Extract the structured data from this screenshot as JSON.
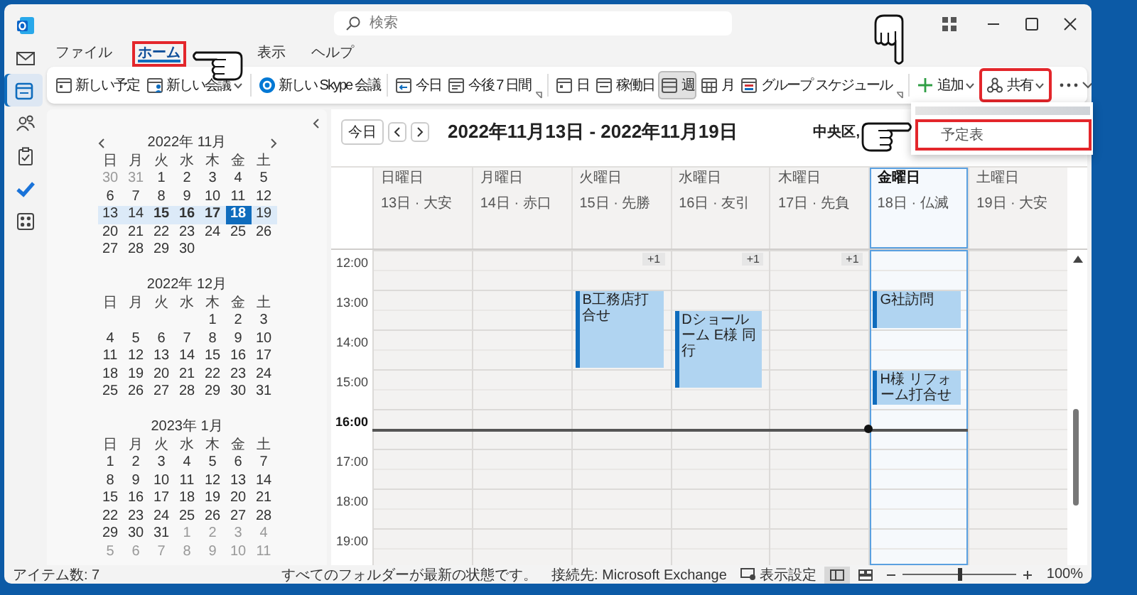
{
  "window": {
    "search": {
      "placeholder": "検索"
    }
  },
  "nav_rail": [
    {
      "selected": false
    },
    {
      "selected": true
    },
    {
      "selected": false
    },
    {
      "selected": false
    },
    {
      "selected": false
    },
    {
      "selected": false
    }
  ],
  "menu_tabs": [
    {
      "label": "ファイル",
      "selected": false,
      "annotated": false
    },
    {
      "label": "ホーム",
      "selected": true,
      "annotated": true
    },
    {
      "label": "表示",
      "selected": false,
      "annotated": false
    },
    {
      "label": "ヘルプ",
      "selected": false,
      "annotated": false
    }
  ],
  "ribbon": {
    "groups": [
      {
        "launcher": false,
        "items": [
          {
            "label": "新しい予定",
            "dropdown": false,
            "selected": false,
            "annotated": false
          },
          {
            "label": "新しい会議",
            "dropdown": true,
            "selected": false,
            "annotated": false
          }
        ]
      },
      {
        "launcher": false,
        "items": [
          {
            "label": "新しい Skype 会議",
            "dropdown": false,
            "selected": false,
            "annotated": false
          }
        ]
      },
      {
        "launcher": true,
        "items": [
          {
            "label": "今日",
            "dropdown": false,
            "selected": false,
            "annotated": false
          },
          {
            "label": "今後 7 日間",
            "dropdown": false,
            "selected": false,
            "annotated": false
          }
        ]
      },
      {
        "launcher": true,
        "items": [
          {
            "label": "日",
            "dropdown": false,
            "selected": false,
            "annotated": false
          },
          {
            "label": "稼働日",
            "dropdown": false,
            "selected": false,
            "annotated": false
          },
          {
            "label": "週",
            "dropdown": false,
            "selected": true,
            "annotated": false
          },
          {
            "label": "月",
            "dropdown": false,
            "selected": false,
            "annotated": false
          },
          {
            "label": "グループ スケジュール",
            "dropdown": false,
            "selected": false,
            "annotated": false
          }
        ]
      },
      {
        "launcher": false,
        "items": [
          {
            "label": "追加",
            "dropdown": true,
            "selected": false,
            "annotated": false
          },
          {
            "label": "共有",
            "dropdown": true,
            "selected": false,
            "annotated": true
          }
        ]
      }
    ]
  },
  "share_menu": {
    "items": [
      {
        "label": "予定表",
        "annotated": true
      }
    ]
  },
  "mini_calendars": [
    {
      "title": "2022年 11月",
      "weekdays": [
        "日",
        "月",
        "火",
        "水",
        "木",
        "金",
        "土"
      ],
      "weeks": [
        {
          "selected": false,
          "days": [
            {
              "day": "30",
              "muted": true,
              "bold": false,
              "selected": false
            },
            {
              "day": "31",
              "muted": true,
              "bold": false,
              "selected": false
            },
            {
              "day": "1",
              "muted": false,
              "bold": false,
              "selected": false
            },
            {
              "day": "2",
              "muted": false,
              "bold": false,
              "selected": false
            },
            {
              "day": "3",
              "muted": false,
              "bold": false,
              "selected": false
            },
            {
              "day": "4",
              "muted": false,
              "bold": false,
              "selected": false
            },
            {
              "day": "5",
              "muted": false,
              "bold": false,
              "selected": false
            }
          ]
        },
        {
          "selected": false,
          "days": [
            {
              "day": "6",
              "muted": false,
              "bold": false,
              "selected": false
            },
            {
              "day": "7",
              "muted": false,
              "bold": false,
              "selected": false
            },
            {
              "day": "8",
              "muted": false,
              "bold": false,
              "selected": false
            },
            {
              "day": "9",
              "muted": false,
              "bold": false,
              "selected": false
            },
            {
              "day": "10",
              "muted": false,
              "bold": false,
              "selected": false
            },
            {
              "day": "11",
              "muted": false,
              "bold": false,
              "selected": false
            },
            {
              "day": "12",
              "muted": false,
              "bold": false,
              "selected": false
            }
          ]
        },
        {
          "selected": true,
          "days": [
            {
              "day": "13",
              "muted": false,
              "bold": false,
              "selected": false
            },
            {
              "day": "14",
              "muted": false,
              "bold": false,
              "selected": false
            },
            {
              "day": "15",
              "muted": false,
              "bold": true,
              "selected": false
            },
            {
              "day": "16",
              "muted": false,
              "bold": true,
              "selected": false
            },
            {
              "day": "17",
              "muted": false,
              "bold": true,
              "selected": false
            },
            {
              "day": "18",
              "muted": false,
              "bold": true,
              "selected": true
            },
            {
              "day": "19",
              "muted": false,
              "bold": false,
              "selected": false
            }
          ]
        },
        {
          "selected": false,
          "days": [
            {
              "day": "20",
              "muted": false,
              "bold": false,
              "selected": false
            },
            {
              "day": "21",
              "muted": false,
              "bold": false,
              "selected": false
            },
            {
              "day": "22",
              "muted": false,
              "bold": false,
              "selected": false
            },
            {
              "day": "23",
              "muted": false,
              "bold": false,
              "selected": false
            },
            {
              "day": "24",
              "muted": false,
              "bold": false,
              "selected": false
            },
            {
              "day": "25",
              "muted": false,
              "bold": false,
              "selected": false
            },
            {
              "day": "26",
              "muted": false,
              "bold": false,
              "selected": false
            }
          ]
        },
        {
          "selected": false,
          "days": [
            {
              "day": "27",
              "muted": false,
              "bold": false,
              "selected": false
            },
            {
              "day": "28",
              "muted": false,
              "bold": false,
              "selected": false
            },
            {
              "day": "29",
              "muted": false,
              "bold": false,
              "selected": false
            },
            {
              "day": "30",
              "muted": false,
              "bold": false,
              "selected": false
            }
          ]
        }
      ]
    },
    {
      "title": "2022年 12月",
      "weekdays": [
        "日",
        "月",
        "火",
        "水",
        "木",
        "金",
        "土"
      ],
      "weeks": [
        {
          "selected": false,
          "days": [
            {
              "day": "1",
              "muted": false,
              "bold": false,
              "selected": false
            },
            {
              "day": "2",
              "muted": false,
              "bold": false,
              "selected": false
            },
            {
              "day": "3",
              "muted": false,
              "bold": false,
              "selected": false
            }
          ]
        },
        {
          "selected": false,
          "days": [
            {
              "day": "4",
              "muted": false,
              "bold": false,
              "selected": false
            },
            {
              "day": "5",
              "muted": false,
              "bold": false,
              "selected": false
            },
            {
              "day": "6",
              "muted": false,
              "bold": false,
              "selected": false
            },
            {
              "day": "7",
              "muted": false,
              "bold": false,
              "selected": false
            },
            {
              "day": "8",
              "muted": false,
              "bold": false,
              "selected": false
            },
            {
              "day": "9",
              "muted": false,
              "bold": false,
              "selected": false
            },
            {
              "day": "10",
              "muted": false,
              "bold": false,
              "selected": false
            }
          ]
        },
        {
          "selected": false,
          "days": [
            {
              "day": "11",
              "muted": false,
              "bold": false,
              "selected": false
            },
            {
              "day": "12",
              "muted": false,
              "bold": false,
              "selected": false
            },
            {
              "day": "13",
              "muted": false,
              "bold": false,
              "selected": false
            },
            {
              "day": "14",
              "muted": false,
              "bold": false,
              "selected": false
            },
            {
              "day": "15",
              "muted": false,
              "bold": false,
              "selected": false
            },
            {
              "day": "16",
              "muted": false,
              "bold": false,
              "selected": false
            },
            {
              "day": "17",
              "muted": false,
              "bold": false,
              "selected": false
            }
          ]
        },
        {
          "selected": false,
          "days": [
            {
              "day": "18",
              "muted": false,
              "bold": false,
              "selected": false
            },
            {
              "day": "19",
              "muted": false,
              "bold": false,
              "selected": false
            },
            {
              "day": "20",
              "muted": false,
              "bold": false,
              "selected": false
            },
            {
              "day": "21",
              "muted": false,
              "bold": false,
              "selected": false
            },
            {
              "day": "22",
              "muted": false,
              "bold": false,
              "selected": false
            },
            {
              "day": "23",
              "muted": false,
              "bold": false,
              "selected": false
            },
            {
              "day": "24",
              "muted": false,
              "bold": false,
              "selected": false
            }
          ]
        },
        {
          "selected": false,
          "days": [
            {
              "day": "25",
              "muted": false,
              "bold": false,
              "selected": false
            },
            {
              "day": "26",
              "muted": false,
              "bold": false,
              "selected": false
            },
            {
              "day": "27",
              "muted": false,
              "bold": false,
              "selected": false
            },
            {
              "day": "28",
              "muted": false,
              "bold": false,
              "selected": false
            },
            {
              "day": "29",
              "muted": false,
              "bold": false,
              "selected": false
            },
            {
              "day": "30",
              "muted": false,
              "bold": false,
              "selected": false
            },
            {
              "day": "31",
              "muted": false,
              "bold": false,
              "selected": false
            }
          ]
        }
      ]
    },
    {
      "title": "2023年 1月",
      "weekdays": [
        "日",
        "月",
        "火",
        "水",
        "木",
        "金",
        "土"
      ],
      "weeks": [
        {
          "selected": false,
          "days": [
            {
              "day": "1",
              "muted": false,
              "bold": false,
              "selected": false
            },
            {
              "day": "2",
              "muted": false,
              "bold": false,
              "selected": false
            },
            {
              "day": "3",
              "muted": false,
              "bold": false,
              "selected": false
            },
            {
              "day": "4",
              "muted": false,
              "bold": false,
              "selected": false
            },
            {
              "day": "5",
              "muted": false,
              "bold": false,
              "selected": false
            },
            {
              "day": "6",
              "muted": false,
              "bold": false,
              "selected": false
            },
            {
              "day": "7",
              "muted": false,
              "bold": false,
              "selected": false
            }
          ]
        },
        {
          "selected": false,
          "days": [
            {
              "day": "8",
              "muted": false,
              "bold": false,
              "selected": false
            },
            {
              "day": "9",
              "muted": false,
              "bold": false,
              "selected": false
            },
            {
              "day": "10",
              "muted": false,
              "bold": false,
              "selected": false
            },
            {
              "day": "11",
              "muted": false,
              "bold": false,
              "selected": false
            },
            {
              "day": "12",
              "muted": false,
              "bold": false,
              "selected": false
            },
            {
              "day": "13",
              "muted": false,
              "bold": false,
              "selected": false
            },
            {
              "day": "14",
              "muted": false,
              "bold": false,
              "selected": false
            }
          ]
        },
        {
          "selected": false,
          "days": [
            {
              "day": "15",
              "muted": false,
              "bold": false,
              "selected": false
            },
            {
              "day": "16",
              "muted": false,
              "bold": false,
              "selected": false
            },
            {
              "day": "17",
              "muted": false,
              "bold": false,
              "selected": false
            },
            {
              "day": "18",
              "muted": false,
              "bold": false,
              "selected": false
            },
            {
              "day": "19",
              "muted": false,
              "bold": false,
              "selected": false
            },
            {
              "day": "20",
              "muted": false,
              "bold": false,
              "selected": false
            },
            {
              "day": "21",
              "muted": false,
              "bold": false,
              "selected": false
            }
          ]
        },
        {
          "selected": false,
          "days": [
            {
              "day": "22",
              "muted": false,
              "bold": false,
              "selected": false
            },
            {
              "day": "23",
              "muted": false,
              "bold": false,
              "selected": false
            },
            {
              "day": "24",
              "muted": false,
              "bold": false,
              "selected": false
            },
            {
              "day": "25",
              "muted": false,
              "bold": false,
              "selected": false
            },
            {
              "day": "26",
              "muted": false,
              "bold": false,
              "selected": false
            },
            {
              "day": "27",
              "muted": false,
              "bold": false,
              "selected": false
            },
            {
              "day": "28",
              "muted": false,
              "bold": false,
              "selected": false
            }
          ]
        },
        {
          "selected": false,
          "days": [
            {
              "day": "29",
              "muted": false,
              "bold": false,
              "selected": false
            },
            {
              "day": "30",
              "muted": false,
              "bold": false,
              "selected": false
            },
            {
              "day": "31",
              "muted": false,
              "bold": false,
              "selected": false
            },
            {
              "day": "1",
              "muted": true,
              "bold": false,
              "selected": false
            },
            {
              "day": "2",
              "muted": true,
              "bold": false,
              "selected": false
            },
            {
              "day": "3",
              "muted": true,
              "bold": false,
              "selected": false
            },
            {
              "day": "4",
              "muted": true,
              "bold": false,
              "selected": false
            }
          ]
        },
        {
          "selected": false,
          "days": [
            {
              "day": "5",
              "muted": true,
              "bold": false,
              "selected": false
            },
            {
              "day": "6",
              "muted": true,
              "bold": false,
              "selected": false
            },
            {
              "day": "7",
              "muted": true,
              "bold": false,
              "selected": false
            },
            {
              "day": "8",
              "muted": true,
              "bold": false,
              "selected": false
            },
            {
              "day": "9",
              "muted": true,
              "bold": false,
              "selected": false
            },
            {
              "day": "10",
              "muted": true,
              "bold": false,
              "selected": false
            },
            {
              "day": "11",
              "muted": true,
              "bold": false,
              "selected": false
            }
          ]
        }
      ]
    }
  ],
  "calendar": {
    "today_button": "今日",
    "range_title": "2022年11月13日 - 2022年11月19日",
    "location": "中央区,",
    "hours": [
      {
        "label": "12:00",
        "current": false
      },
      {
        "label": "13:00",
        "current": false
      },
      {
        "label": "14:00",
        "current": false
      },
      {
        "label": "15:00",
        "current": false
      },
      {
        "label": "16:00",
        "current": true
      },
      {
        "label": "17:00",
        "current": false
      },
      {
        "label": "18:00",
        "current": false
      },
      {
        "label": "19:00",
        "current": false
      }
    ],
    "days": [
      {
        "weekday": "日曜日",
        "date": "13日 · 大安",
        "today": false
      },
      {
        "weekday": "月曜日",
        "date": "14日 · 赤口",
        "today": false
      },
      {
        "weekday": "火曜日",
        "date": "15日 · 先勝",
        "today": false,
        "more": "+1",
        "events": [
          {
            "title": "B工務店打合せ"
          }
        ]
      },
      {
        "weekday": "水曜日",
        "date": "16日 · 友引",
        "today": false,
        "more": "+1",
        "events": [
          {
            "title": "Dショールーム E様 同行"
          }
        ]
      },
      {
        "weekday": "木曜日",
        "date": "17日 · 先負",
        "today": false,
        "more": "+1"
      },
      {
        "weekday": "金曜日",
        "date": "18日 · 仏滅",
        "today": true,
        "events": [
          {
            "title": "G社訪問"
          },
          {
            "title": "H様 リフォーム打合せ"
          }
        ]
      },
      {
        "weekday": "土曜日",
        "date": "19日 · 大安",
        "today": false
      }
    ]
  },
  "status_bar": {
    "item_count": "アイテム数: 7",
    "sync_status": "すべてのフォルダーが最新の状態です。",
    "connection": "接続先: Microsoft Exchange",
    "view_settings": "表示設定",
    "view_modes": [
      {
        "selected": true
      },
      {
        "selected": false
      }
    ],
    "zoom": {
      "level": 0.5,
      "label": "100%"
    }
  }
}
